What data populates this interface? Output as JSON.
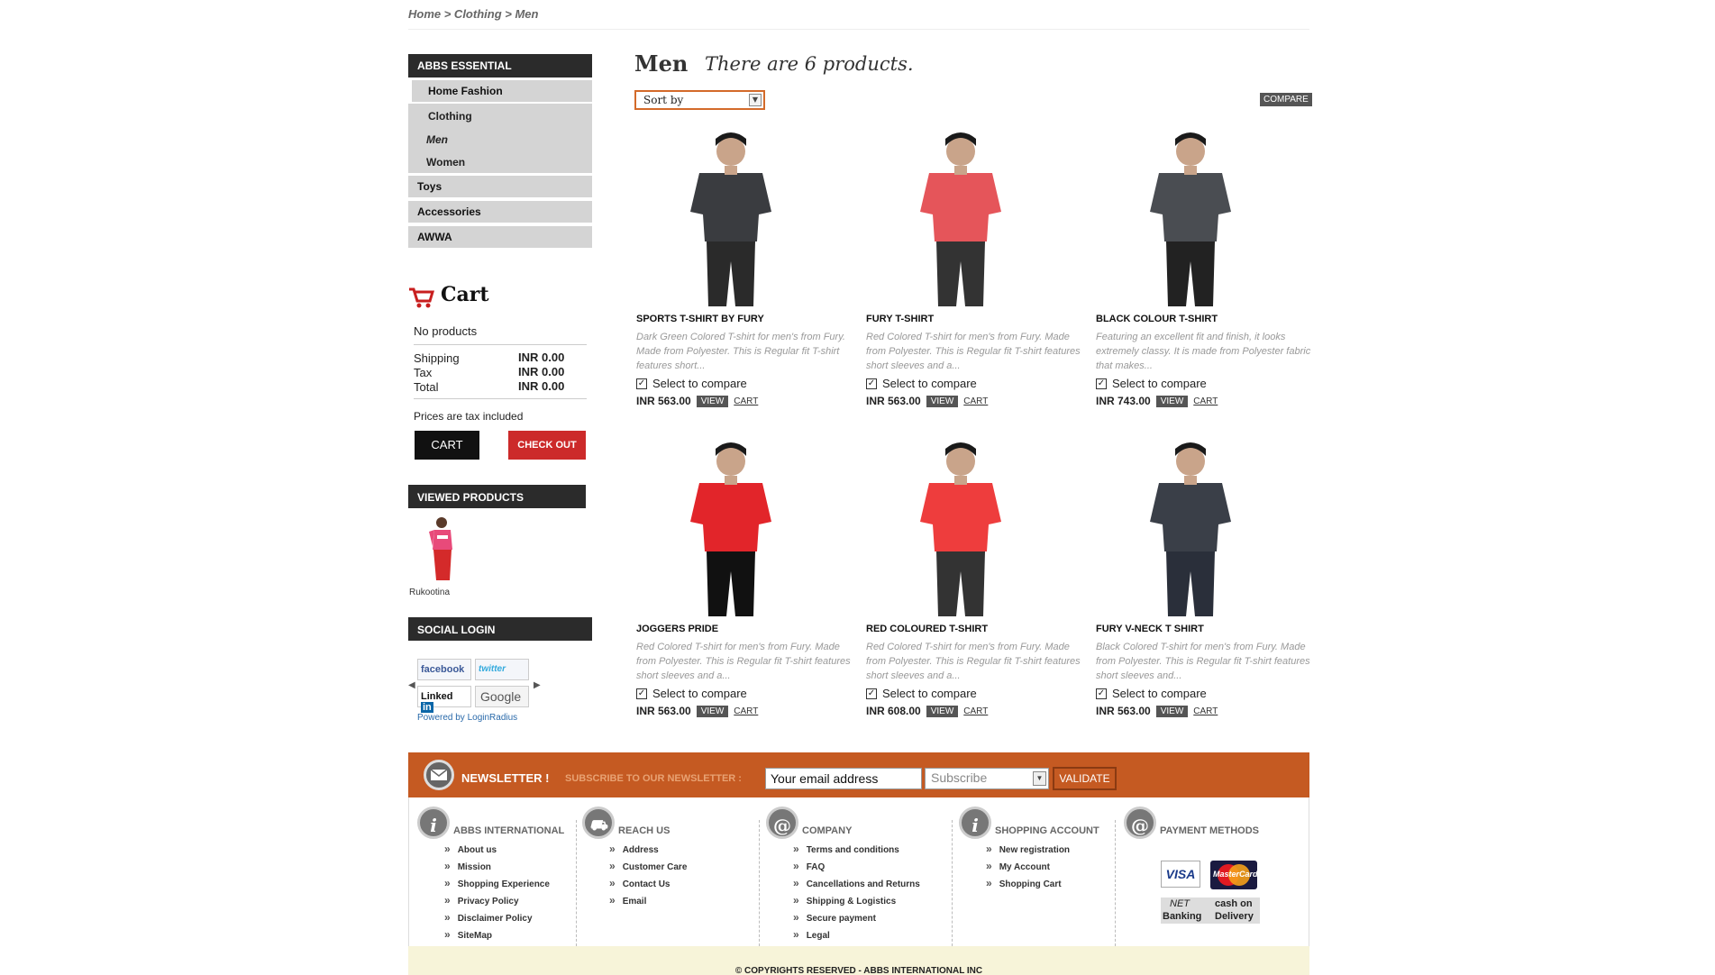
{
  "breadcrumb": "Home > Clothing > Men",
  "sidebar": {
    "brand": "ABBS ESSENTIAL",
    "items": [
      {
        "label": "Home Fashion"
      },
      {
        "label": "Clothing"
      },
      {
        "label": "Men"
      },
      {
        "label": "Women"
      },
      {
        "label": "Toys"
      },
      {
        "label": "Accessories"
      },
      {
        "label": "AWWA"
      }
    ]
  },
  "cart": {
    "title": "Cart",
    "empty_text": "No products",
    "shipping_label": "Shipping",
    "shipping_value": "INR 0.00",
    "tax_label": "Tax",
    "tax_value": "INR 0.00",
    "total_label": "Total",
    "total_value": "INR 0.00",
    "tax_note": "Prices are tax included",
    "cart_button": "CART",
    "checkout_button": "CHECK OUT"
  },
  "viewed": {
    "title": "VIEWED PRODUCTS",
    "item_label": "Rukootina"
  },
  "social": {
    "title": "SOCIAL LOGIN",
    "facebook": "facebook",
    "twitter": "twitter",
    "linkedin": "Linked",
    "linkedin_in": "in",
    "google": "Google",
    "powered": "Powered by LoginRadius"
  },
  "main": {
    "title": "Men",
    "subtitle": "There are 6 products.",
    "sort_label": "Sort by",
    "compare_label": "COMPARE"
  },
  "products": [
    {
      "name": "SPORTS T-SHIRT BY FURY",
      "desc": "Dark Green Colored T-shirt for men's from Fury. Made from Polyester. This is Regular fit T-shirt features short...",
      "price": "INR 563.00",
      "shirt": "#3a3c40",
      "pants": "#2a2a2a"
    },
    {
      "name": "FURY T-SHIRT",
      "desc": "Red Colored T-shirt for men's from Fury. Made from Polyester. This is Regular fit T-shirt features short sleeves and a...",
      "price": "INR 563.00",
      "shirt": "#e5555a",
      "pants": "#333333"
    },
    {
      "name": "BLACK COLOUR T-SHIRT",
      "desc": "Featuring an excellent fit and finish, it looks extremely classy. It is made from Polyester fabric that makes...",
      "price": "INR 743.00",
      "shirt": "#4a4d52",
      "pants": "#222222"
    },
    {
      "name": "JOGGERS PRIDE",
      "desc": "Red Colored T-shirt for men's from Fury. Made from Polyester. This is Regular fit T-shirt features short sleeves and a...",
      "price": "INR 563.00",
      "shirt": "#e2252a",
      "pants": "#111111"
    },
    {
      "name": "RED COLOURED T-SHIRT",
      "desc": "Red Colored T-shirt for men's from Fury. Made from Polyester. This is Regular fit T-shirt features short sleeves and a...",
      "price": "INR 608.00",
      "shirt": "#ee3d3d",
      "pants": "#333333"
    },
    {
      "name": "FURY V-NECK T SHIRT",
      "desc": "Black Colored T-shirt for men's from Fury. Made from Polyester. This is Regular fit T-shirt features short sleeves and...",
      "price": "INR 563.00",
      "shirt": "#3a3f48",
      "pants": "#2a2f3a"
    }
  ],
  "product_labels": {
    "select": "Select to compare",
    "view": "VIEW",
    "cart": "CART"
  },
  "newsletter": {
    "title": "NEWSLETTER !",
    "subtitle": "SUBSCRIBE TO OUR NEWSLETTER :",
    "email_value": "Your email address",
    "select_value": "Subscribe",
    "button": "VALIDATE"
  },
  "footer": {
    "col1": {
      "title": "ABBS INTERNATIONAL",
      "links": [
        "About us",
        "Mission",
        "Shopping Experience",
        "Privacy Policy",
        "Disclaimer Policy",
        "SiteMap"
      ]
    },
    "col2": {
      "title": "REACH US",
      "links": [
        "Address",
        "Customer Care",
        "Contact Us",
        "Email"
      ]
    },
    "col3": {
      "title": "COMPANY",
      "links": [
        "Terms and conditions",
        "FAQ",
        "Cancellations and Returns",
        "Shipping & Logistics",
        "Secure payment",
        "Legal"
      ]
    },
    "col4": {
      "title": "SHOPPING ACCOUNT",
      "links": [
        "New registration",
        "My Account",
        "Shopping Cart"
      ]
    },
    "col5": {
      "title": "PAYMENT METHODS",
      "visa": "VISA",
      "mastercard": "MasterCard",
      "net": "NET",
      "banking": "Banking",
      "cash": "cash on",
      "delivery": "Delivery"
    }
  },
  "copyright": "© COPYRIGHTS RESERVED - ABBS INTERNATIONAL INC",
  "colors": {
    "accent": "#c55a22",
    "dark": "#2b2b2b",
    "checkout": "#cc2a2a"
  }
}
